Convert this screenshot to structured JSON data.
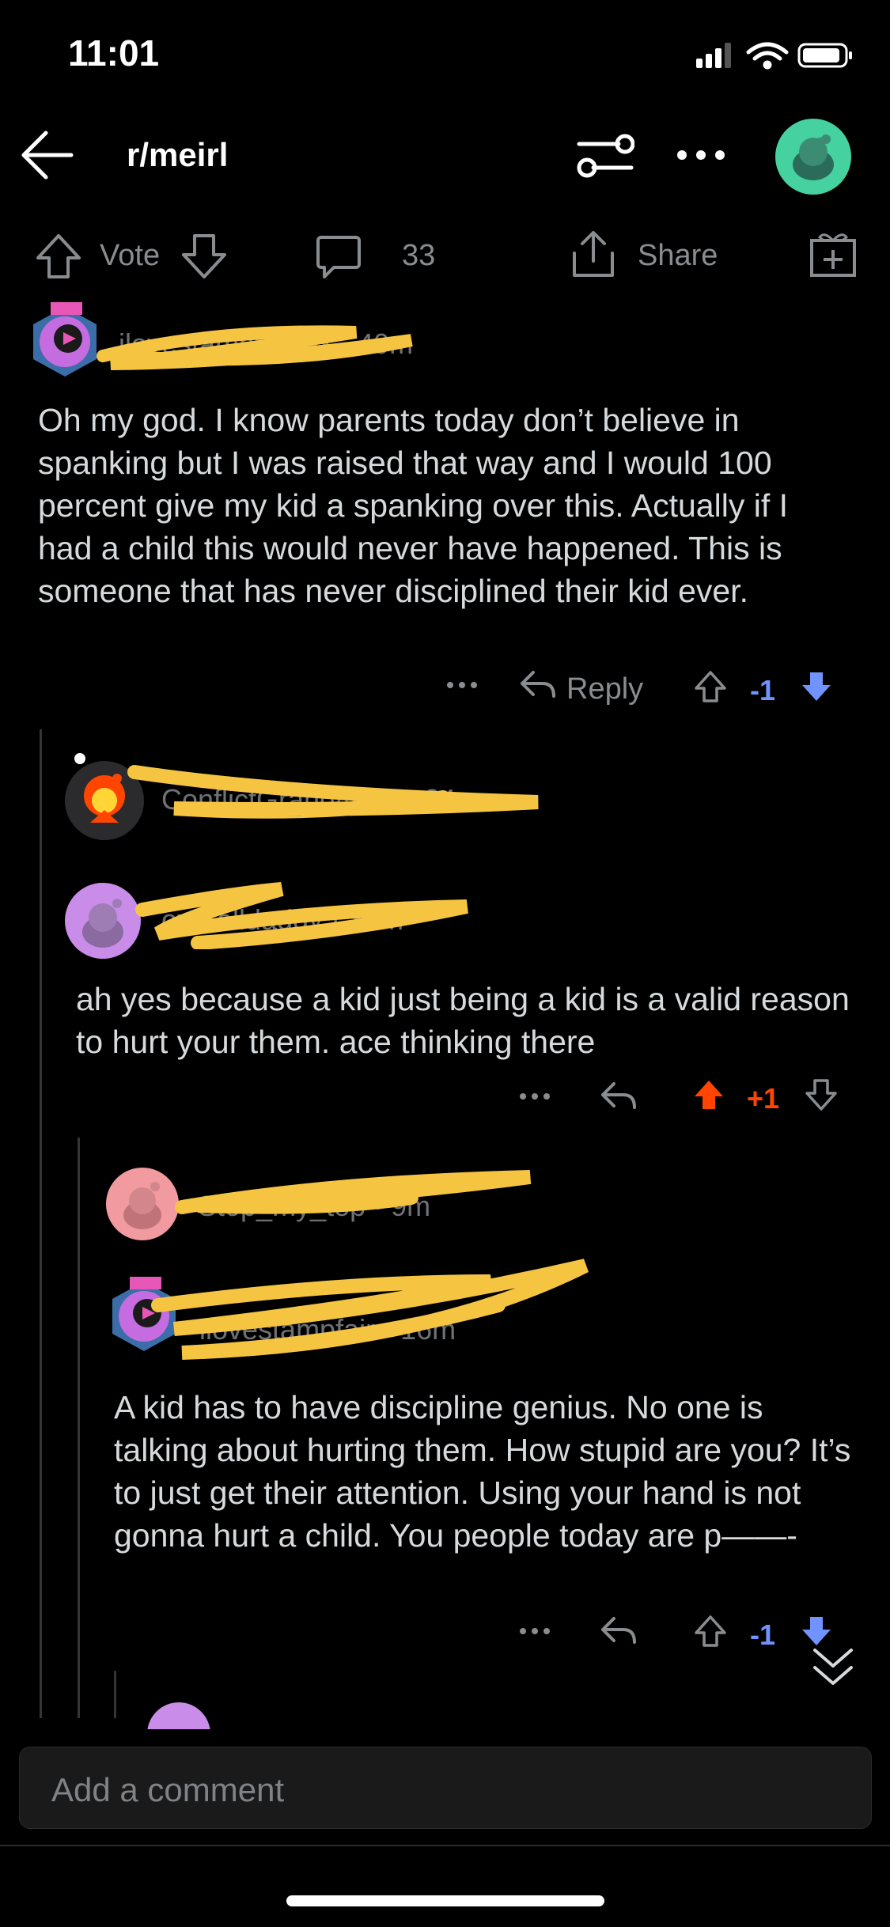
{
  "status": {
    "time": "11:01"
  },
  "nav": {
    "title": "r/meirl"
  },
  "post_bar": {
    "vote_label": "Vote",
    "comments_count": "33",
    "share_label": "Share"
  },
  "colors": {
    "accent_down": "#7193ff",
    "accent_up": "#ff4500",
    "avatar_teal": "#46d160"
  },
  "comments": [
    {
      "meta": "ilovestampfairtex · 40m",
      "text": "Oh my god. I know parents today don’t believe in spanking but I was raised that way and I would 100 percent give my kid a spanking over this. Actually if I had a child this would never have happened. This is someone that has never disciplined their kid ever.",
      "reply_label": "Reply",
      "score": "-1"
    },
    {
      "meta": "ConflictGrand4078 · 34m"
    },
    {
      "meta": "overalldaddy · 30m",
      "text": "ah yes because a kid just being a kid is a valid reason to hurt your them. ace thinking there",
      "score": "+1"
    },
    {
      "meta": "Stop_my_top · 9m"
    },
    {
      "meta": "ilovestampfair · 16m",
      "text": "A kid has to have discipline genius. No one is talking about hurting them. How stupid are you? It’s to just get their attention. Using your hand is not gonna hurt a child. You people today are p——-",
      "score": "-1"
    }
  ],
  "composer": {
    "placeholder": "Add a comment"
  }
}
